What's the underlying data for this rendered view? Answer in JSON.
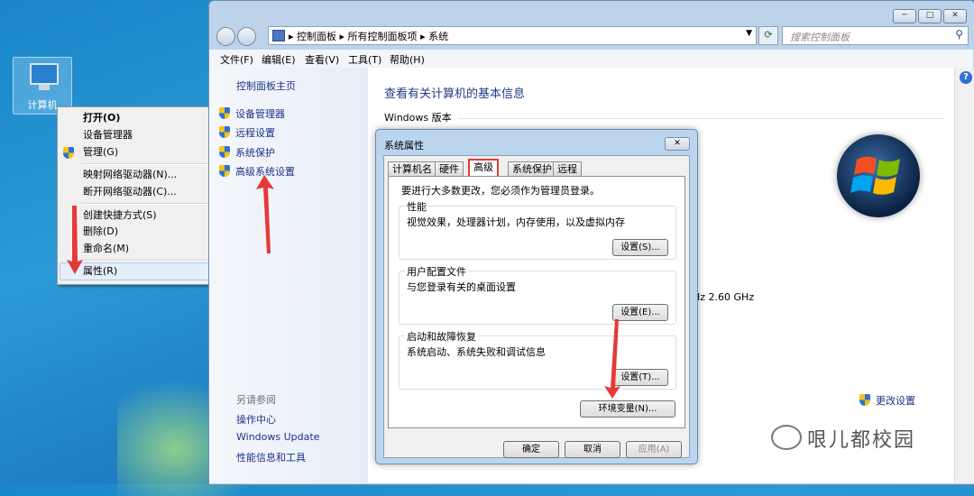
{
  "desktop": {
    "icon_label": "计算机"
  },
  "context_menu": {
    "items": [
      "打开(O)",
      "设备管理器",
      "管理(G)",
      "映射网络驱动器(N)...",
      "断开网络驱动器(C)...",
      "创建快捷方式(S)",
      "删除(D)",
      "重命名(M)",
      "属性(R)"
    ]
  },
  "window": {
    "breadcrumb": [
      "控制面板",
      "所有控制面板项",
      "系统"
    ],
    "search_placeholder": "搜索控制面板",
    "menu": [
      "文件(F)",
      "编辑(E)",
      "查看(V)",
      "工具(T)",
      "帮助(H)"
    ],
    "left": {
      "home": "控制面板主页",
      "links": [
        "设备管理器",
        "远程设置",
        "系统保护",
        "高级系统设置"
      ],
      "see_also": "另请参阅",
      "see_also_links": [
        "操作中心",
        "Windows Update",
        "性能信息和工具"
      ]
    },
    "content": {
      "heading": "查看有关计算机的基本信息",
      "edition_label": "Windows 版本",
      "cpu_fragment": "Hz   2.60 GHz",
      "change_settings": "更改设置"
    }
  },
  "dialog": {
    "title": "系统属性",
    "tabs": [
      "计算机名",
      "硬件",
      "高级",
      "系统保护",
      "远程"
    ],
    "notice": "要进行大多数更改，您必须作为管理员登录。",
    "groups": [
      {
        "title": "性能",
        "desc": "视觉效果，处理器计划，内存使用，以及虚拟内存",
        "button": "设置(S)..."
      },
      {
        "title": "用户配置文件",
        "desc": "与您登录有关的桌面设置",
        "button": "设置(E)..."
      },
      {
        "title": "启动和故障恢复",
        "desc": "系统启动、系统失败和调试信息",
        "button": "设置(T)..."
      }
    ],
    "env_button": "环境变量(N)...",
    "ok": "确定",
    "cancel": "取消",
    "apply": "应用(A)"
  },
  "watermark": "哏儿都校园",
  "colors": {
    "accent_red": "#e53935",
    "link_blue": "#1e3287"
  }
}
